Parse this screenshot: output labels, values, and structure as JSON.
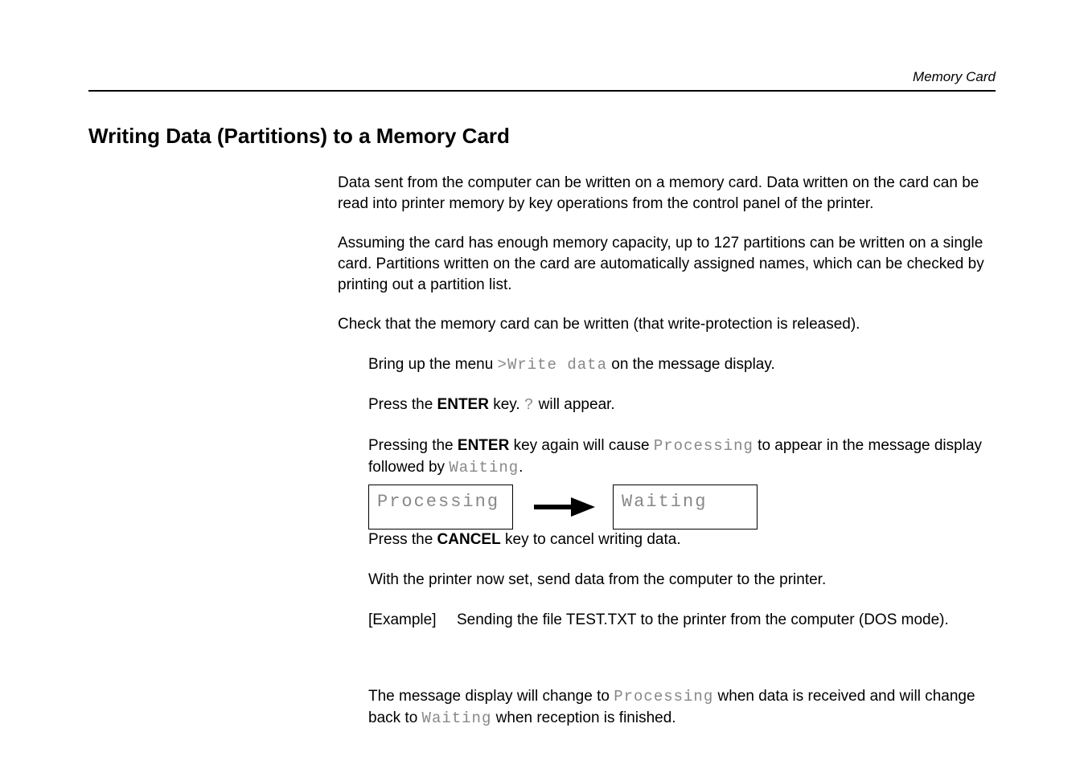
{
  "header": {
    "right": "Memory Card"
  },
  "title": "Writing Data (Partitions) to a Memory Card",
  "body": {
    "p1": "Data sent from the computer can be written on a memory card.  Data written on the card can be read into printer memory by key operations from the control panel of the printer.",
    "p2": "Assuming the card has enough memory capacity, up to 127 partitions can be written on a single card. Partitions written on the card are automatically assigned names, which can be checked by printing out a partition list.",
    "p3": "Check that the memory card can be written (that write-protection is released).",
    "step1_pre": "Bring up the menu ",
    "step1_code": ">Write data",
    "step1_post": " on the message display.",
    "step2_pre": "Press the ",
    "enter": "ENTER",
    "step2_mid": " key. ",
    "step2_code": "?",
    "step2_post": " will appear.",
    "step3_pre": "Pressing the ",
    "step3_mid": " key again will cause ",
    "processing": "Processing",
    "step3_mid2": " to appear in the message display followed by ",
    "waiting": "Waiting",
    "period": ".",
    "lcd1": "Processing",
    "lcd2": "Waiting",
    "step4_pre": "Press the ",
    "cancel": "CANCEL",
    "step4_post": " key to cancel writing data.",
    "step5": "With the printer now set, send data from the computer to the printer.",
    "example_label": "[Example]",
    "example_text": "Sending the file TEST.TXT to the printer from the computer (DOS mode).",
    "step6_pre": "The message display will change to ",
    "step6_mid": " when data is received and will change back to ",
    "step6_post": " when reception is finished."
  }
}
